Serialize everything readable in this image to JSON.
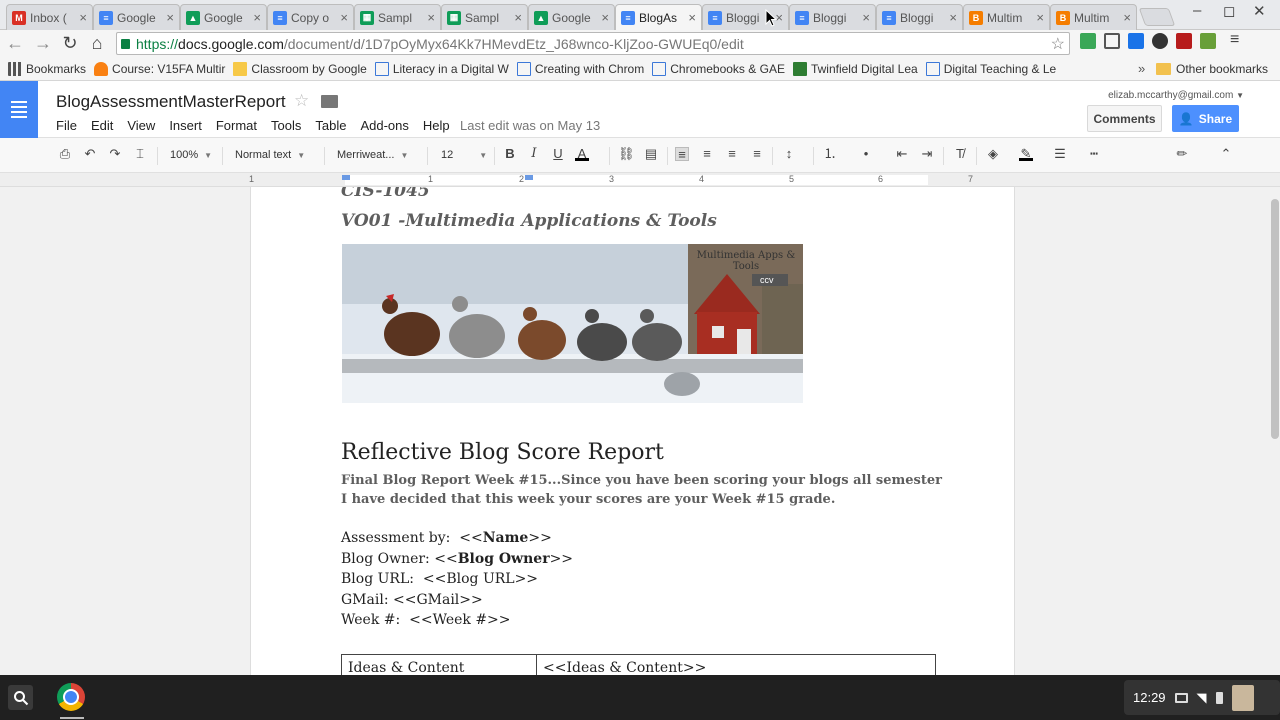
{
  "browser": {
    "tabs": [
      {
        "title": "Inbox (",
        "icon": "gmail-icon",
        "color": "#d93025",
        "glyph": "M"
      },
      {
        "title": "Google",
        "icon": "docs-icon",
        "color": "#4285f4",
        "glyph": "≡"
      },
      {
        "title": "Google",
        "icon": "drive-icon",
        "color": "#0f9d58",
        "glyph": "▲"
      },
      {
        "title": "Copy o",
        "icon": "docs-icon",
        "color": "#4285f4",
        "glyph": "≡"
      },
      {
        "title": "Sampl",
        "icon": "sheets-icon",
        "color": "#0f9d58",
        "glyph": "▦"
      },
      {
        "title": "Sampl",
        "icon": "sheets-icon",
        "color": "#0f9d58",
        "glyph": "▦"
      },
      {
        "title": "Google",
        "icon": "drive-icon",
        "color": "#0f9d58",
        "glyph": "▲"
      },
      {
        "title": "BlogAs",
        "icon": "docs-icon",
        "color": "#4285f4",
        "glyph": "≡",
        "active": true
      },
      {
        "title": "Bloggi",
        "icon": "docs-icon",
        "color": "#4285f4",
        "glyph": "≡"
      },
      {
        "title": "Bloggi",
        "icon": "docs-icon",
        "color": "#4285f4",
        "glyph": "≡"
      },
      {
        "title": "Bloggi",
        "icon": "docs-icon",
        "color": "#4285f4",
        "glyph": "≡"
      },
      {
        "title": "Multim",
        "icon": "blogger-icon",
        "color": "#f57d00",
        "glyph": "B"
      },
      {
        "title": "Multim",
        "icon": "blogger-icon",
        "color": "#f57d00",
        "glyph": "B"
      }
    ],
    "url_scheme": "https://",
    "url_host": "docs.google.com",
    "url_path": "/document/d/1D7pOyMyx64Kk7HMevdEtz_J68wnco-KljZoo-GWUEq0/edit",
    "bookmarks": [
      {
        "label": "Bookmarks",
        "icon": "bookmarks-apps-icon"
      },
      {
        "label": "Course: V15FA Multir",
        "icon": "moodle-icon"
      },
      {
        "label": "Classroom by Google",
        "icon": "classroom-icon"
      },
      {
        "label": "Literacy in a Digital W",
        "icon": "page-icon"
      },
      {
        "label": "Creating with Chrom",
        "icon": "page-icon"
      },
      {
        "label": "Chromebooks & GAE",
        "icon": "page-icon"
      },
      {
        "label": "Twinfield Digital Lea",
        "icon": "twinfield-icon"
      },
      {
        "label": "Digital Teaching & Le",
        "icon": "page-icon"
      }
    ],
    "overflow": "»",
    "other_bookmarks": "Other bookmarks"
  },
  "docs": {
    "title": "BlogAssessmentMasterReport",
    "menu": [
      "File",
      "Edit",
      "View",
      "Insert",
      "Format",
      "Tools",
      "Table",
      "Add-ons",
      "Help"
    ],
    "last_edit": "Last edit was on May 13",
    "account": "elizab.mccarthy@gmail.com",
    "comments": "Comments",
    "share": "Share",
    "toolbar": {
      "zoom": "100%",
      "style": "Normal text",
      "font": "Merriweat...",
      "size": "12"
    },
    "ruler_numbers": [
      "1",
      "1",
      "2",
      "3",
      "4",
      "5",
      "6",
      "7"
    ]
  },
  "document": {
    "course": "CIS-1045",
    "subtitle": "VO01 -Multimedia Applications & Tools",
    "banner_text": "Multimedia Apps & Tools",
    "banner_tag": "ccv",
    "heading": "Reflective Blog Score Report",
    "note_line1": "Final Blog Report Week #15...Since you have been scoring your blogs all semester",
    "note_line2": "I have decided that this week your scores are your Week #15 grade.",
    "fields": [
      {
        "label": "Assessment by:  ",
        "value": "<<Name>>",
        "bold_core": "Name"
      },
      {
        "label": "Blog Owner: ",
        "value": "<<Blog Owner>>",
        "bold_core": "Blog Owner"
      },
      {
        "label": "Blog URL:  ",
        "value": "<<Blog URL>>"
      },
      {
        "label": "GMail: ",
        "value": "<<GMail>>"
      },
      {
        "label": "Week #:  ",
        "value": "<<Week #>>"
      }
    ],
    "table_row": [
      "Ideas & Content",
      "<<Ideas & Content>>"
    ]
  },
  "shelf": {
    "time": "12:29"
  }
}
